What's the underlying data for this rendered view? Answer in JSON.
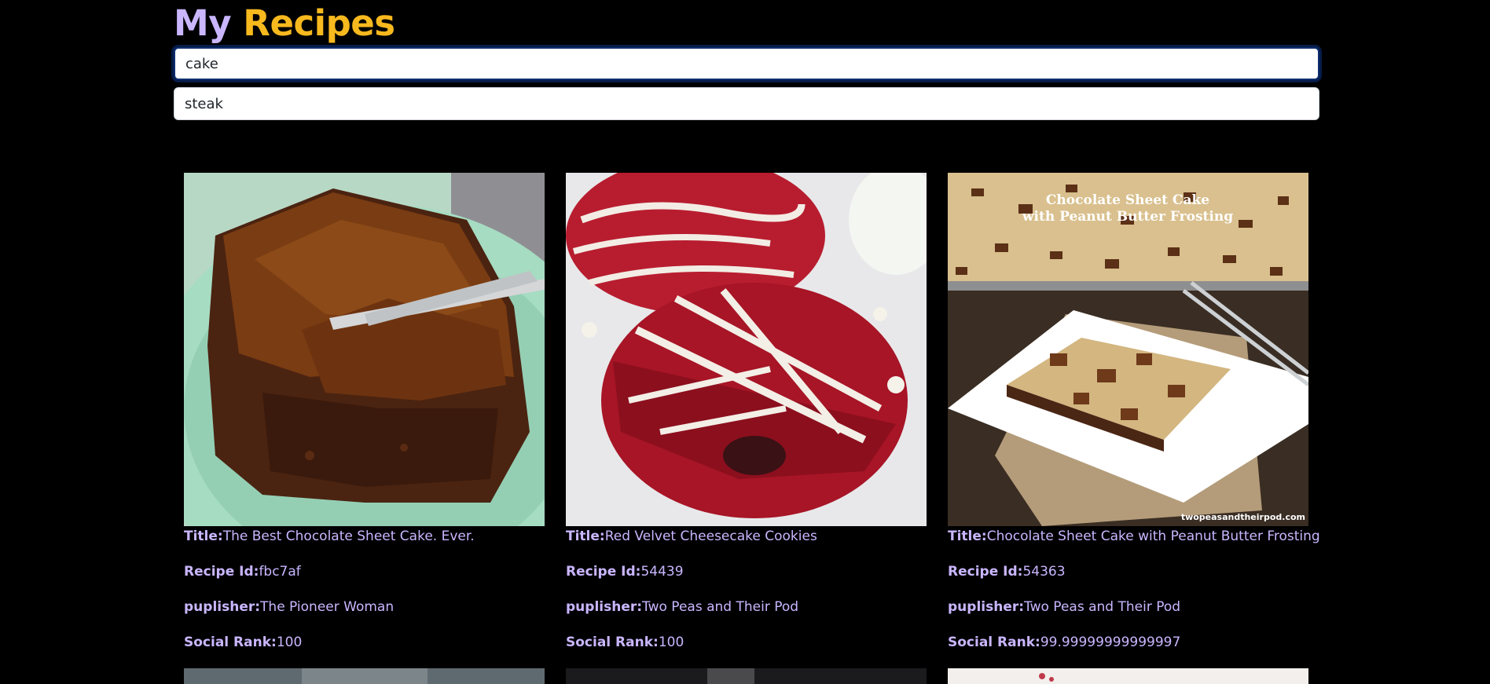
{
  "header": {
    "title_word1": "My",
    "title_word2": "Recipes"
  },
  "searches": [
    {
      "value": "cake"
    },
    {
      "value": "steak"
    }
  ],
  "labels": {
    "title": "Title:",
    "recipe_id": "Recipe Id:",
    "publisher": "puplisher:",
    "social_rank": "Social Rank:"
  },
  "recipes": [
    {
      "title": "The Best Chocolate Sheet Cake. Ever.",
      "recipe_id": "fbc7af",
      "publisher": "The Pioneer Woman",
      "social_rank": "100"
    },
    {
      "title": "Red Velvet Cheesecake Cookies",
      "recipe_id": "54439",
      "publisher": "Two Peas and Their Pod",
      "social_rank": "100"
    },
    {
      "title": "Chocolate Sheet Cake with Peanut Butter Frosting",
      "recipe_id": "54363",
      "publisher": "Two Peas and Their Pod",
      "social_rank": "99.99999999999997",
      "image_caption": "Chocolate Sheet Cake\nwith Peanut Butter Frosting",
      "image_watermark": "twopeasandtheirpod.com"
    }
  ],
  "colors": {
    "background": "#000000",
    "title_primary": "#c9b6ff",
    "title_accent": "#f8b91e",
    "text": "#c9b6ff"
  }
}
